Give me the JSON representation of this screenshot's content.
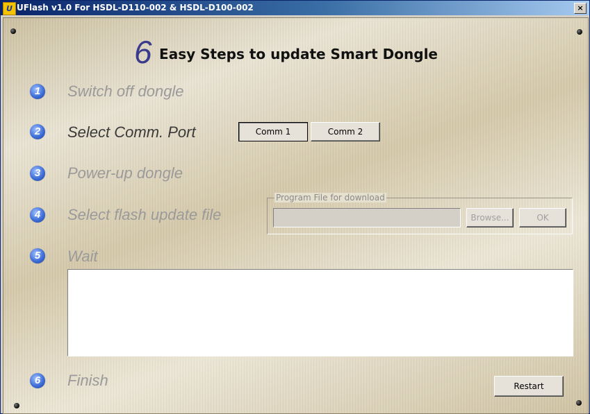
{
  "window": {
    "title": "UFlash v1.0 For HSDL-D110-002 & HSDL-D100-002",
    "app_icon_text": "U",
    "close_label": "×"
  },
  "heading": {
    "number": "6",
    "text": "Easy Steps to update Smart Dongle"
  },
  "steps": [
    {
      "num": "1",
      "label": "Switch off dongle"
    },
    {
      "num": "2",
      "label": "Select Comm. Port"
    },
    {
      "num": "3",
      "label": "Power-up dongle"
    },
    {
      "num": "4",
      "label": "Select flash update file"
    },
    {
      "num": "5",
      "label": "Wait"
    },
    {
      "num": "6",
      "label": "Finish"
    }
  ],
  "comm": {
    "port1_label": "Comm 1",
    "port2_label": "Comm 2",
    "selected": "Comm 1"
  },
  "program_file": {
    "legend": "Program File for download",
    "value": "",
    "browse_label": "Browse...",
    "ok_label": "OK"
  },
  "log": {
    "text": ""
  },
  "restart_label": "Restart",
  "colors": {
    "step_active": "#3a3a3a",
    "step_inactive": "#9a9a9a",
    "heading_number": "#3b3b8e",
    "step_badge": "#3f6fd8"
  }
}
